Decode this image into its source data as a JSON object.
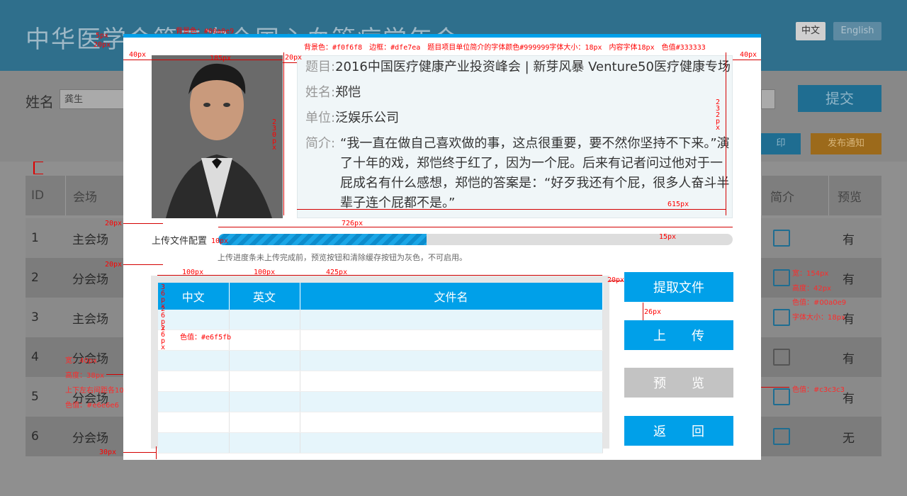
{
  "background": {
    "site_title": "中华医学会第二次全国心血管病学年会",
    "lang_cn": "中文",
    "lang_en": "English",
    "name_label": "姓名",
    "name_value": "龚生",
    "submit": "提交",
    "print_btn": "印",
    "notify_btn": "发布通知",
    "table_head": {
      "id": "ID",
      "venue": "会场",
      "intro": "简介",
      "preview": "预览"
    },
    "rows": [
      {
        "id": "1",
        "venue": "主会场",
        "preview": "有"
      },
      {
        "id": "2",
        "venue": "分会场",
        "preview": "有"
      },
      {
        "id": "3",
        "venue": "主会场",
        "preview": "有"
      },
      {
        "id": "4",
        "venue": "分会场",
        "preview": "有"
      },
      {
        "id": "5",
        "venue": "分会场",
        "preview": "有"
      },
      {
        "id": "6",
        "venue": "分会场",
        "preview": "无"
      }
    ],
    "red_notes": {
      "w": "宽：154px",
      "h": "高度：42px",
      "c": "色值：#00a0e9",
      "f": "字体大小：18px",
      "gray_color": "色值：#c3c3c3",
      "left1": "宽：40px",
      "left2": "高度：38px",
      "left3": "上下左右间距各10px",
      "left4": "色值：#e6e6e6"
    }
  },
  "modal": {
    "accent_color": "#00a0e9",
    "info_bg": "#f0f6f8",
    "info_border": "#dfe7ea",
    "title_label": "题目:",
    "title_value": "2016中国医疗健康产业投资峰会 | 新芽风暴 Venture50医疗健康专场",
    "name_label": "姓名:",
    "name_value": "郑恺",
    "unit_label": "单位:",
    "unit_value": "泛娱乐公司",
    "intro_label": "简介:",
    "intro_value": "“我一直在做自己喜欢做的事，这点很重要，要不然你坚持不下来。”演了十年的戏，郑恺终于红了，因为一个屁。后来有记者问过他对于一屁成名有什么感想，郑恺的答案是：“好歹我还有个屁，很多人奋斗半辈子连个屁都不是。”",
    "upload_label": "上传文件配置",
    "progress": 0.405,
    "progress_note": "上传进度条未上传完成前，预览按钮和清除缓存按钮为灰色，不可启用。",
    "table_headers": [
      "中文",
      "英文",
      "文件名"
    ],
    "buttons": {
      "extract": "提取文件",
      "upload": "上　　传",
      "preview": "预　　览",
      "back": "返　　回"
    }
  },
  "annotations": {
    "bg_color": "背景色：#00a0e9",
    "info_spec": "背景色：#f0f6f8　边框：#dfe7ea　题目项目单位简介的字体颜色#999999字体大小：18px　内容字体18px　色值#333333",
    "px5": "5px",
    "px20a": "20px",
    "px40a": "40px",
    "px185": "185px",
    "px20b": "20px",
    "px40b": "40px",
    "px232": "232px",
    "px230": "230px",
    "px615": "615px",
    "px20c": "20px",
    "px726": "726px",
    "px10": "10px",
    "px15": "15px",
    "px20d": "20px",
    "px100a": "100px",
    "px100b": "100px",
    "px425": "425px",
    "px36": "36px",
    "px26a": "26px",
    "px26b": "26px",
    "row_color": "色值：#e6f5fb",
    "px20e": "20px",
    "px26c": "26px",
    "px30": "30px"
  }
}
